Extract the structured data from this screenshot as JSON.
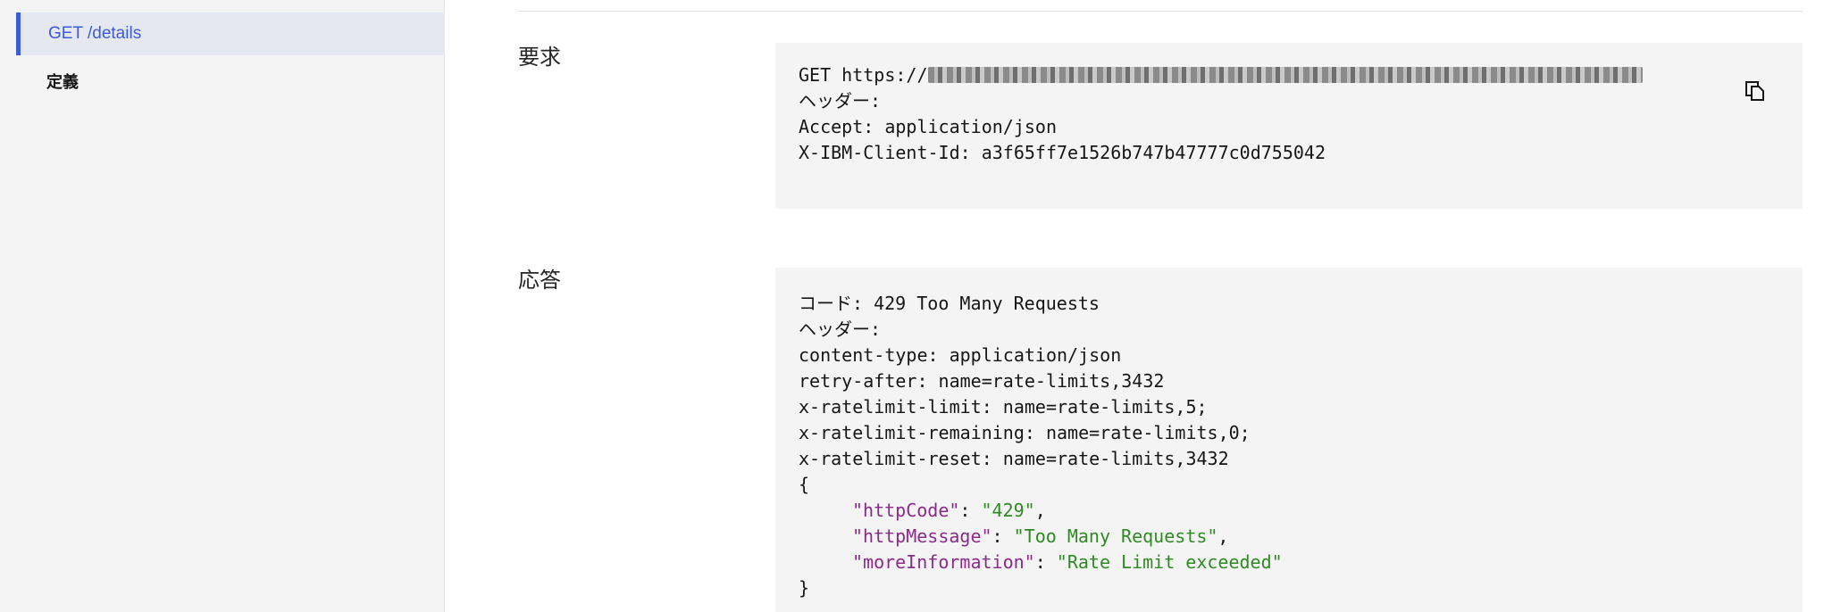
{
  "sidebar": {
    "active_item": "GET /details",
    "items": [
      {
        "label": "定義"
      }
    ]
  },
  "request": {
    "label": "要求",
    "method_url_prefix": "GET https://",
    "headers_title": "ヘッダー:",
    "accept": "Accept: application/json",
    "client_id": "X-IBM-Client-Id: a3f65ff7e1526b747b47777c0d755042"
  },
  "response": {
    "label": "応答",
    "code_line": "コード: 429 Too Many Requests",
    "headers_title": "ヘッダー:",
    "header_lines": [
      "content-type: application/json",
      "retry-after: name=rate-limits,3432",
      "x-ratelimit-limit: name=rate-limits,5;",
      "x-ratelimit-remaining: name=rate-limits,0;",
      "x-ratelimit-reset: name=rate-limits,3432"
    ],
    "open_brace": "{",
    "close_brace": "}",
    "body": [
      {
        "key": "\"httpCode\"",
        "value": "\"429\"",
        "sep": ",",
        "colon": ": "
      },
      {
        "key": "\"httpMessage\"",
        "value": "\"Too Many Requests\"",
        "sep": ",",
        "colon": ": "
      },
      {
        "key": "\"moreInformation\"",
        "value": "\"Rate Limit exceeded\"",
        "sep": "",
        "colon": ": "
      }
    ]
  },
  "colors": {
    "accent": "#3b5bdb",
    "json_key": "#8b2a8b",
    "json_string": "#2e8b22"
  },
  "icons": {
    "copy": "copy-icon"
  }
}
